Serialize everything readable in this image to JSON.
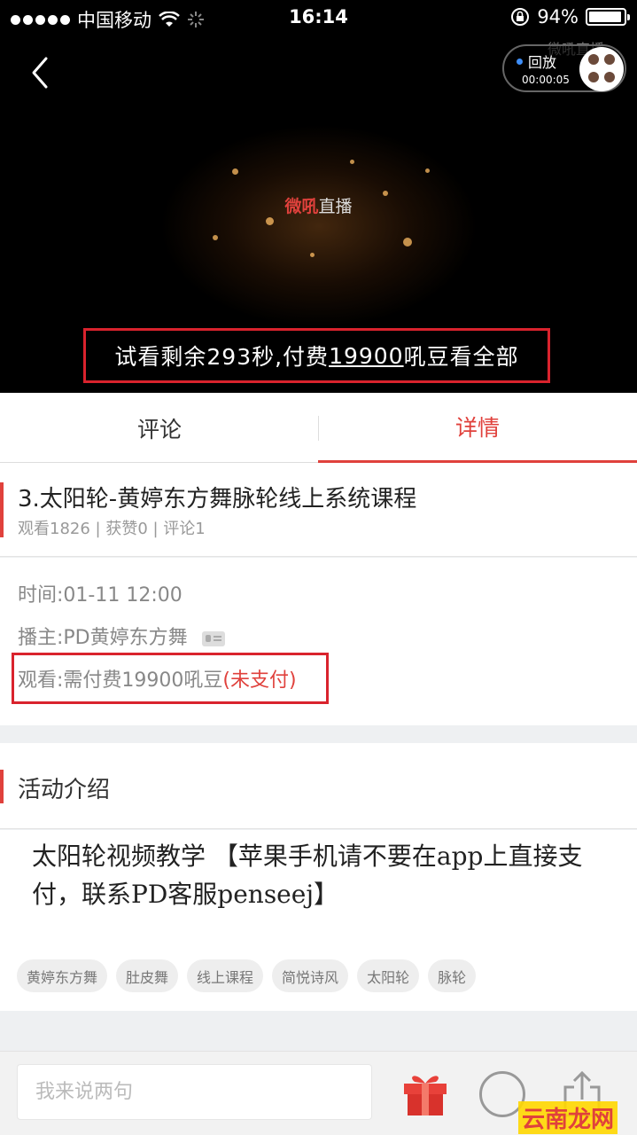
{
  "status_bar": {
    "carrier": "中国移动",
    "time": "16:14",
    "battery": "94%",
    "battery_level": 0.94
  },
  "video": {
    "logo_red": "微吼",
    "logo_rest": "直播",
    "watermark": "微吼直播",
    "replay_label": "回放",
    "replay_time": "00:00:05",
    "trial_prefix": "试看剩余293秒,付费",
    "trial_amount": "19900",
    "trial_suffix": "吼豆看全部"
  },
  "tabs": [
    {
      "label": "评论",
      "active": false
    },
    {
      "label": "详情",
      "active": true
    }
  ],
  "event": {
    "title": "3.太阳轮-黄婷东方舞脉轮线上系统课程",
    "stats": "观看1826 | 获赞0 | 评论1",
    "time": "时间:01-11 12:00",
    "host": "播主:PD黄婷东方舞",
    "view_fee": "观看:需付费19900吼豆",
    "pay_status": "(未支付)"
  },
  "activity": {
    "heading": "活动介绍",
    "description": "太阳轮视频教学 【苹果手机请不要在app上直接支付，联系PD客服penseej】",
    "tags": [
      "黄婷东方舞",
      "肚皮舞",
      "线上课程",
      "简悦诗风",
      "太阳轮",
      "脉轮"
    ]
  },
  "bottom_bar": {
    "comment_placeholder": "我来说两句",
    "site_logo": "云南龙网"
  },
  "colors": {
    "accent": "#e0413c",
    "highlight_box": "#d9232d"
  }
}
